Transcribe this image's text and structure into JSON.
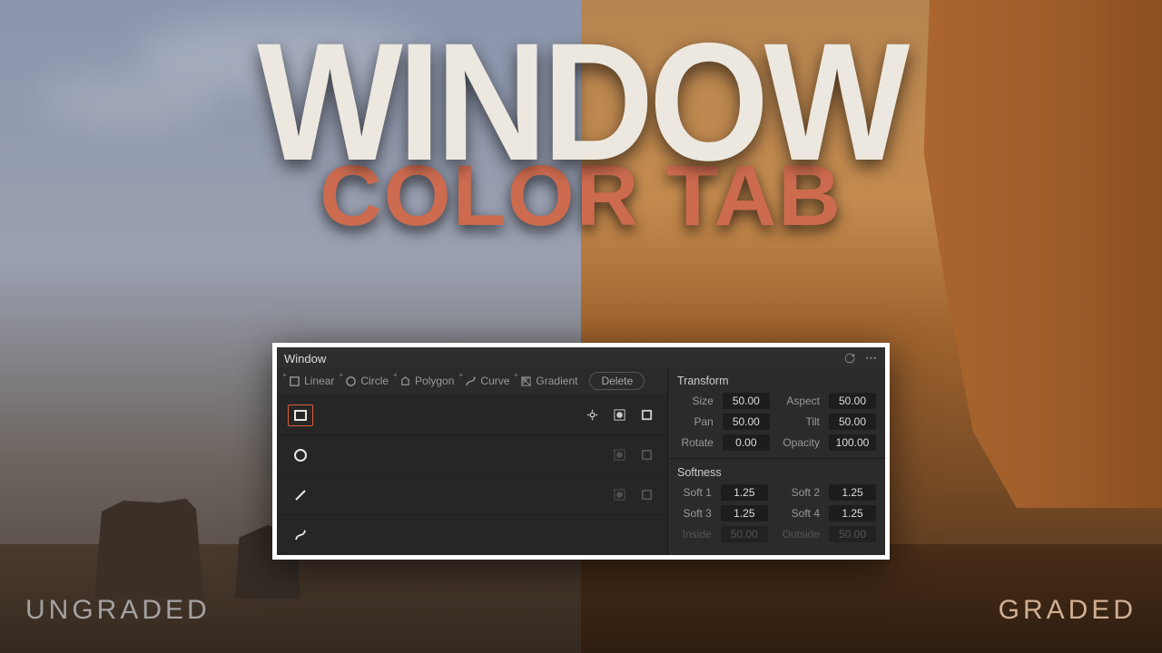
{
  "overlay": {
    "title_main": "WINDOW",
    "title_sub": "COLOR TAB",
    "label_left": "UNGRADED",
    "label_right": "GRADED"
  },
  "panel": {
    "title": "Window",
    "toolbar": {
      "linear": "Linear",
      "circle": "Circle",
      "polygon": "Polygon",
      "curve": "Curve",
      "gradient": "Gradient",
      "delete": "Delete"
    },
    "shapes": [
      {
        "type": "rect",
        "active": true
      },
      {
        "type": "circle",
        "active": false
      },
      {
        "type": "line",
        "active": false
      },
      {
        "type": "curve",
        "active": false
      }
    ],
    "transform": {
      "title": "Transform",
      "size_label": "Size",
      "size": "50.00",
      "aspect_label": "Aspect",
      "aspect": "50.00",
      "pan_label": "Pan",
      "pan": "50.00",
      "tilt_label": "Tilt",
      "tilt": "50.00",
      "rotate_label": "Rotate",
      "rotate": "0.00",
      "opacity_label": "Opacity",
      "opacity": "100.00"
    },
    "softness": {
      "title": "Softness",
      "s1_label": "Soft 1",
      "s1": "1.25",
      "s2_label": "Soft 2",
      "s2": "1.25",
      "s3_label": "Soft 3",
      "s3": "1.25",
      "s4_label": "Soft 4",
      "s4": "1.25",
      "inside_label": "Inside",
      "inside": "50.00",
      "outside_label": "Outside",
      "outside": "50.00"
    }
  }
}
